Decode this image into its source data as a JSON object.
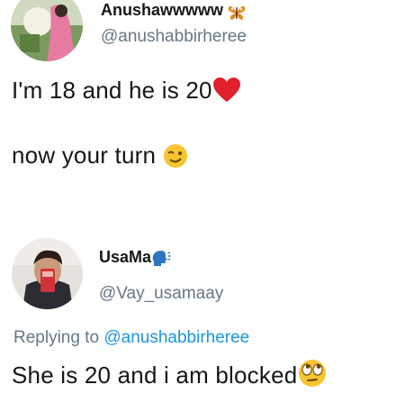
{
  "original_tweet": {
    "display_name": "Anushawwwww",
    "name_emoji": "butterfly-emoji",
    "handle": "@anushabbirheree",
    "line1": "I'm 18 and he is 20",
    "line1_emoji": "red-heart-emoji",
    "line2": "now your turn",
    "line2_emoji": "winking-face-emoji"
  },
  "reply_tweet": {
    "display_name": "UsaMa",
    "name_emoji": "speaking-head-emoji",
    "handle": "@Vay_usamaay",
    "replying_prefix": "Replying to",
    "replying_to": "@anushabbirheree",
    "text": "She is 20 and i am blocked",
    "text_emoji": "face-with-rolling-eyes-emoji"
  },
  "colors": {
    "text": "#14171a",
    "secondary": "#657786",
    "link": "#1b95e0"
  }
}
